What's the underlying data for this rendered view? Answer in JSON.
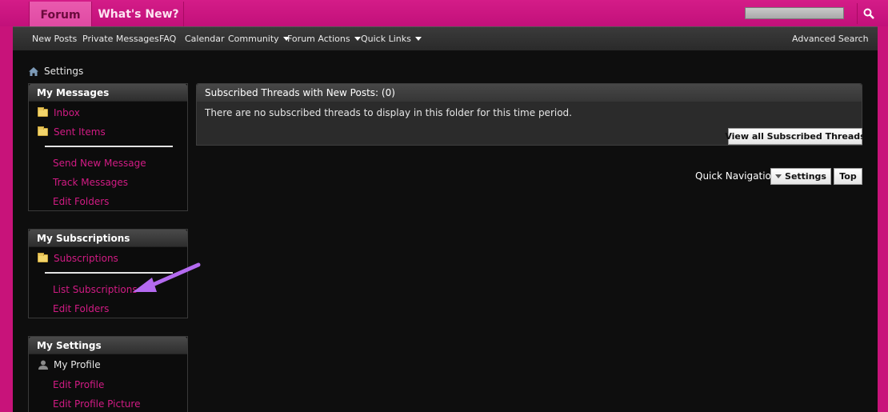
{
  "header": {
    "tab_forum": "Forum",
    "tab_whats_new": "What's New?",
    "search_placeholder": ""
  },
  "navbar": {
    "items": [
      "New Posts",
      "Private Messages",
      "FAQ",
      "Calendar",
      "Community",
      "Forum Actions",
      "Quick Links"
    ],
    "advanced_search": "Advanced Search"
  },
  "breadcrumb": {
    "current": "Settings"
  },
  "sidebar": {
    "messages": {
      "title": "My Messages",
      "inbox": "Inbox",
      "sent": "Sent Items",
      "send_new": "Send New Message",
      "track": "Track Messages",
      "edit_folders": "Edit Folders"
    },
    "subscriptions": {
      "title": "My Subscriptions",
      "subscriptions": "Subscriptions",
      "list": "List Subscriptions",
      "edit_folders": "Edit Folders"
    },
    "settings": {
      "title": "My Settings",
      "my_profile": "My Profile",
      "edit_profile": "Edit Profile",
      "edit_picture": "Edit Profile Picture"
    }
  },
  "content": {
    "panel_title": "Subscribed Threads with New Posts: (0)",
    "empty_message": "There are no subscribed threads to display in this folder for this time period.",
    "view_all_button": "View all Subscribed Threads",
    "quick_nav_label": "Quick Navigation",
    "quick_nav_select": "Settings",
    "top_button": "Top"
  },
  "colors": {
    "brand_pink": "#c8137a",
    "link_pink": "#d21b84",
    "annotation_arrow": "#b46af0"
  },
  "icons": {
    "home": "home-icon",
    "search": "search-icon",
    "folder": "folder-icon",
    "person": "person-icon",
    "annotation": "annotation-arrow"
  }
}
